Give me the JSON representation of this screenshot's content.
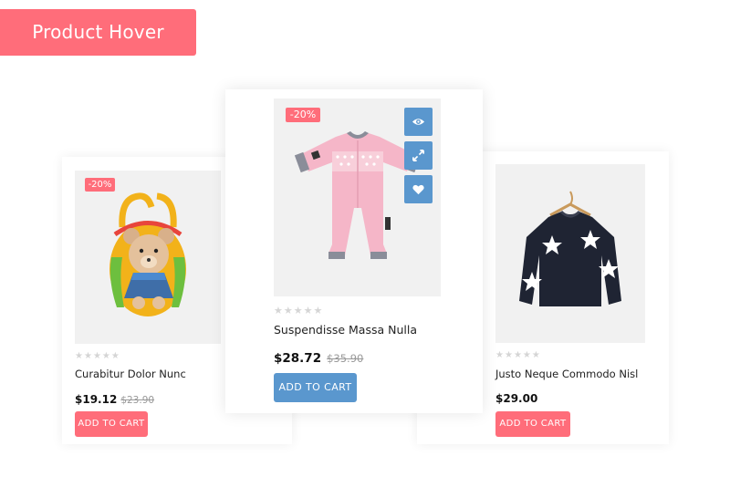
{
  "header": {
    "title": "Product Hover"
  },
  "products": {
    "left": {
      "badge": "-20%",
      "name": "Curabitur Dolor Nunc",
      "price": "$19.12",
      "old_price": "$23.90",
      "rating": 0,
      "cart_label": "ADD TO CART",
      "image_icon": "teddy-backpack-image"
    },
    "center": {
      "badge": "-20%",
      "name": "Suspendisse Massa Nulla",
      "price": "$28.72",
      "old_price": "$35.90",
      "rating": 0,
      "cart_label": "ADD TO CART",
      "image_icon": "pink-romper-image",
      "actions": [
        "eye-icon",
        "compare-icon",
        "heart-icon"
      ]
    },
    "right": {
      "name": "Justo Neque Commodo Nisl",
      "price": "$29.00",
      "rating": 0,
      "cart_label": "ADD TO CART",
      "image_icon": "star-sweater-image"
    }
  },
  "colors": {
    "accent_pink": "#ff6d7a",
    "accent_blue": "#5a97ce",
    "image_bg": "#f1f1f1"
  }
}
